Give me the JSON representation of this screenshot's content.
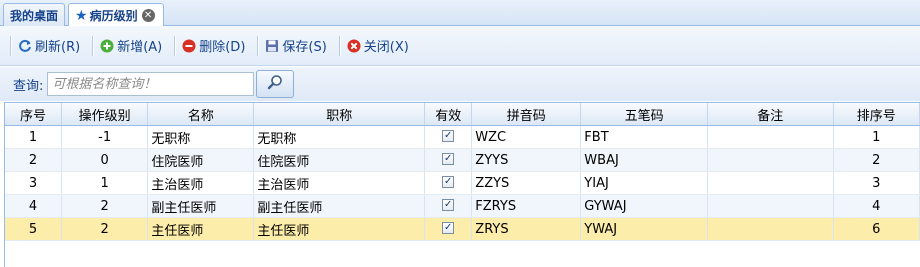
{
  "tabs": [
    {
      "label": "我的桌面",
      "active": false
    },
    {
      "label": "病历级别",
      "active": true,
      "icon": "star-icon"
    }
  ],
  "toolbar": {
    "buttons": [
      {
        "label": "刷新(R)",
        "icon": "refresh-icon"
      },
      {
        "label": "新增(A)",
        "icon": "add-icon"
      },
      {
        "label": "删除(D)",
        "icon": "delete-icon"
      },
      {
        "label": "保存(S)",
        "icon": "save-icon"
      },
      {
        "label": "关闭(X)",
        "icon": "close-icon"
      }
    ]
  },
  "search": {
    "label": "查询:",
    "placeholder": "可根据名称查询！",
    "value": ""
  },
  "grid": {
    "columns": [
      "序号",
      "操作级别",
      "名称",
      "职称",
      "有效",
      "拼音码",
      "五笔码",
      "备注",
      "排序号"
    ],
    "rows": [
      {
        "no": "1",
        "level": "-1",
        "name": "无职称",
        "title": "无职称",
        "valid": true,
        "pinyin": "WZC",
        "wubi": "FBT",
        "note": "",
        "sort": "1"
      },
      {
        "no": "2",
        "level": "0",
        "name": "住院医师",
        "title": "住院医师",
        "valid": true,
        "pinyin": "ZYYS",
        "wubi": "WBAJ",
        "note": "",
        "sort": "2"
      },
      {
        "no": "3",
        "level": "1",
        "name": "主治医师",
        "title": "主治医师",
        "valid": true,
        "pinyin": "ZZYS",
        "wubi": "YIAJ",
        "note": "",
        "sort": "3"
      },
      {
        "no": "4",
        "level": "2",
        "name": "副主任医师",
        "title": "副主任医师",
        "valid": true,
        "pinyin": "FZRYS",
        "wubi": "GYWAJ",
        "note": "",
        "sort": "4"
      },
      {
        "no": "5",
        "level": "2",
        "name": "主任医师",
        "title": "主任医师",
        "valid": true,
        "pinyin": "ZRYS",
        "wubi": "YWAJ",
        "note": "",
        "sort": "6"
      }
    ],
    "selected_row": 4
  },
  "colors": {
    "accent": "#15428b",
    "selected": "#fdedaa",
    "border": "#99bbe8"
  }
}
